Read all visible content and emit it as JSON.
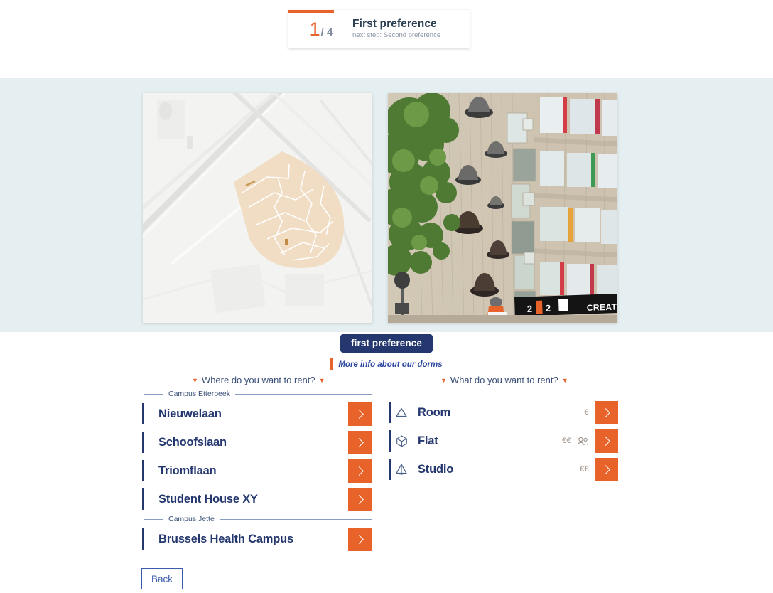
{
  "progress": {
    "current_step": "1",
    "total_steps": "/ 4",
    "title": "First preference",
    "next_step": "next step: Second preference",
    "percent": 25,
    "accent_color": "#e8632a"
  },
  "media": {
    "map_image_name": "campus-map",
    "building_image_name": "dorm-building-photo",
    "building_sign_text": "CREATIVITY",
    "building_sign_numbers": [
      "2",
      "2"
    ]
  },
  "badge": {
    "label": "first preference",
    "background": "#24376f"
  },
  "info_link": {
    "label": "More info about our dorms",
    "color": "#2d47a0",
    "accent_bar": "#e8632a"
  },
  "columns": {
    "left": {
      "heading": "Where do you want to rent?",
      "groups": [
        {
          "label": "Campus Etterbeek",
          "items": [
            {
              "label": "Nieuwelaan"
            },
            {
              "label": "Schoofslaan"
            },
            {
              "label": "Triomflaan"
            },
            {
              "label": "Student House XY"
            }
          ]
        },
        {
          "label": "Campus Jette",
          "items": [
            {
              "label": "Brussels Health Campus"
            }
          ]
        }
      ]
    },
    "right": {
      "heading": "What do you want to rent?",
      "items": [
        {
          "label": "Room",
          "icon": "triangle-icon",
          "price": "€",
          "extra_icon": ""
        },
        {
          "label": "Flat",
          "icon": "cube-icon",
          "price": "€€",
          "extra_icon": "people-icon"
        },
        {
          "label": "Studio",
          "icon": "pyramid-icon",
          "price": "€€",
          "extra_icon": ""
        }
      ]
    }
  },
  "footer": {
    "back_label": "Back"
  },
  "theme": {
    "orange": "#e8632a",
    "navy": "#24376f",
    "band_blue": "#e5eef1"
  }
}
